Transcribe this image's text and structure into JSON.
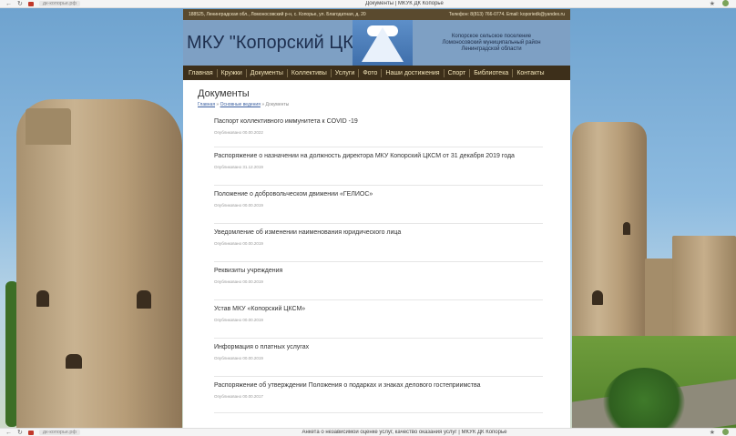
{
  "browser": {
    "top_url": "дк-копорье.рф",
    "top_title": "Документы | МКУК ДК Копорье",
    "bottom_url": "дк-копорье.рф",
    "bottom_title": "Анкета о независимой оценке услуг, качество оказания услуг | МКУК ДК Копорье"
  },
  "header": {
    "address": "188525, Ленинградская обл., Ломоносовский р-н, с. Копорье, ул. Благодатная, д. 20",
    "contacts": "Телефон: 8(813) 766-0774. Email: koporiedk@yandex.ru",
    "site_title": "МКУ \"Копорский ЦКСМ\"",
    "region_line1": "Копорское сельское поселение",
    "region_line2": "Ломоносовский муниципальный район",
    "region_line3": "Ленинградской области"
  },
  "nav": [
    "Главная",
    "Кружки",
    "Документы",
    "Коллективы",
    "Услуги",
    "Фото",
    "Наши достижения",
    "Спорт",
    "Библиотека",
    "Контакты"
  ],
  "page": {
    "title": "Документы",
    "breadcrumb": [
      "Главная",
      "Основные ведения",
      "Документы"
    ]
  },
  "documents": [
    {
      "title": "Паспорт коллективного иммунитета к COVID -19",
      "date": "Опубликовано 00.00.2022"
    },
    {
      "title": "Распоряжение о назначении на должность директора МКУ Копорский ЦКСМ от 31 декабря 2019 года",
      "date": "Опубликовано 31.12.2019"
    },
    {
      "title": "Положение о добровольческом движении «ГЕЛИОС»",
      "date": "Опубликовано 00.00.2019"
    },
    {
      "title": "Уведомление об изменении наименования юридического лица",
      "date": "Опубликовано 00.00.2019"
    },
    {
      "title": "Реквизиты учреждения",
      "date": "Опубликовано 00.00.2019"
    },
    {
      "title": "Устав МКУ «Копорский ЦКСМ»",
      "date": "Опубликовано 00.00.2019"
    },
    {
      "title": "Информация о платных услугах",
      "date": "Опубликовано 00.00.2019"
    },
    {
      "title": "Распоряжение об утверждении Положения о подарках и знаках делового гостеприимства",
      "date": "Опубликовано 00.00.2017"
    }
  ]
}
